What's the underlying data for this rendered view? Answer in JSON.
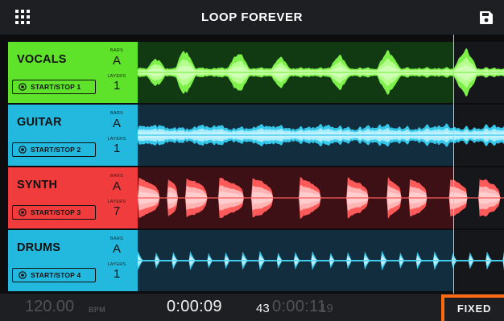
{
  "app": {
    "title": "LOOP FOREVER",
    "menu_icon": "grid-icon",
    "save_icon": "save-icon"
  },
  "tracks": [
    {
      "name": "VOCALS",
      "bars_label": "BARS",
      "bars": "A",
      "layers_label": "LAYERS",
      "layers": "1",
      "button_label": "START/STOP 1",
      "color": "#5fe32a",
      "bg": "#123a12",
      "wave": "#7df04a",
      "wave_light": "#b6ff8e",
      "pattern": "vocal"
    },
    {
      "name": "GUITAR",
      "bars_label": "BARS",
      "bars": "A",
      "layers_label": "LAYERS",
      "layers": "1",
      "button_label": "START/STOP 2",
      "color": "#23b8dd",
      "bg": "#122e3e",
      "wave": "#35c8ea",
      "wave_light": "#a5ecff",
      "pattern": "guitar"
    },
    {
      "name": "SYNTH",
      "bars_label": "BARS",
      "bars": "A",
      "layers_label": "LAYERS",
      "layers": "7",
      "button_label": "START/STOP 3",
      "color": "#f03c3c",
      "bg": "#3c1014",
      "wave": "#ff5a5a",
      "wave_light": "#ffb3b3",
      "pattern": "synth"
    },
    {
      "name": "DRUMS",
      "bars_label": "BARS",
      "bars": "A",
      "layers_label": "LAYERS",
      "layers": "1",
      "button_label": "START/STOP 4",
      "color": "#23b8dd",
      "bg": "#122e3e",
      "wave": "#35c8ea",
      "wave_light": "#a5ecff",
      "pattern": "drums"
    }
  ],
  "transport": {
    "bpm": "120.00",
    "bpm_unit": "BPM",
    "position": "0:00:09",
    "position_frac": "43",
    "length": "0:00:11",
    "length_frac": "19",
    "mode_button": "FIXED",
    "accent_color": "#ff6a13"
  }
}
